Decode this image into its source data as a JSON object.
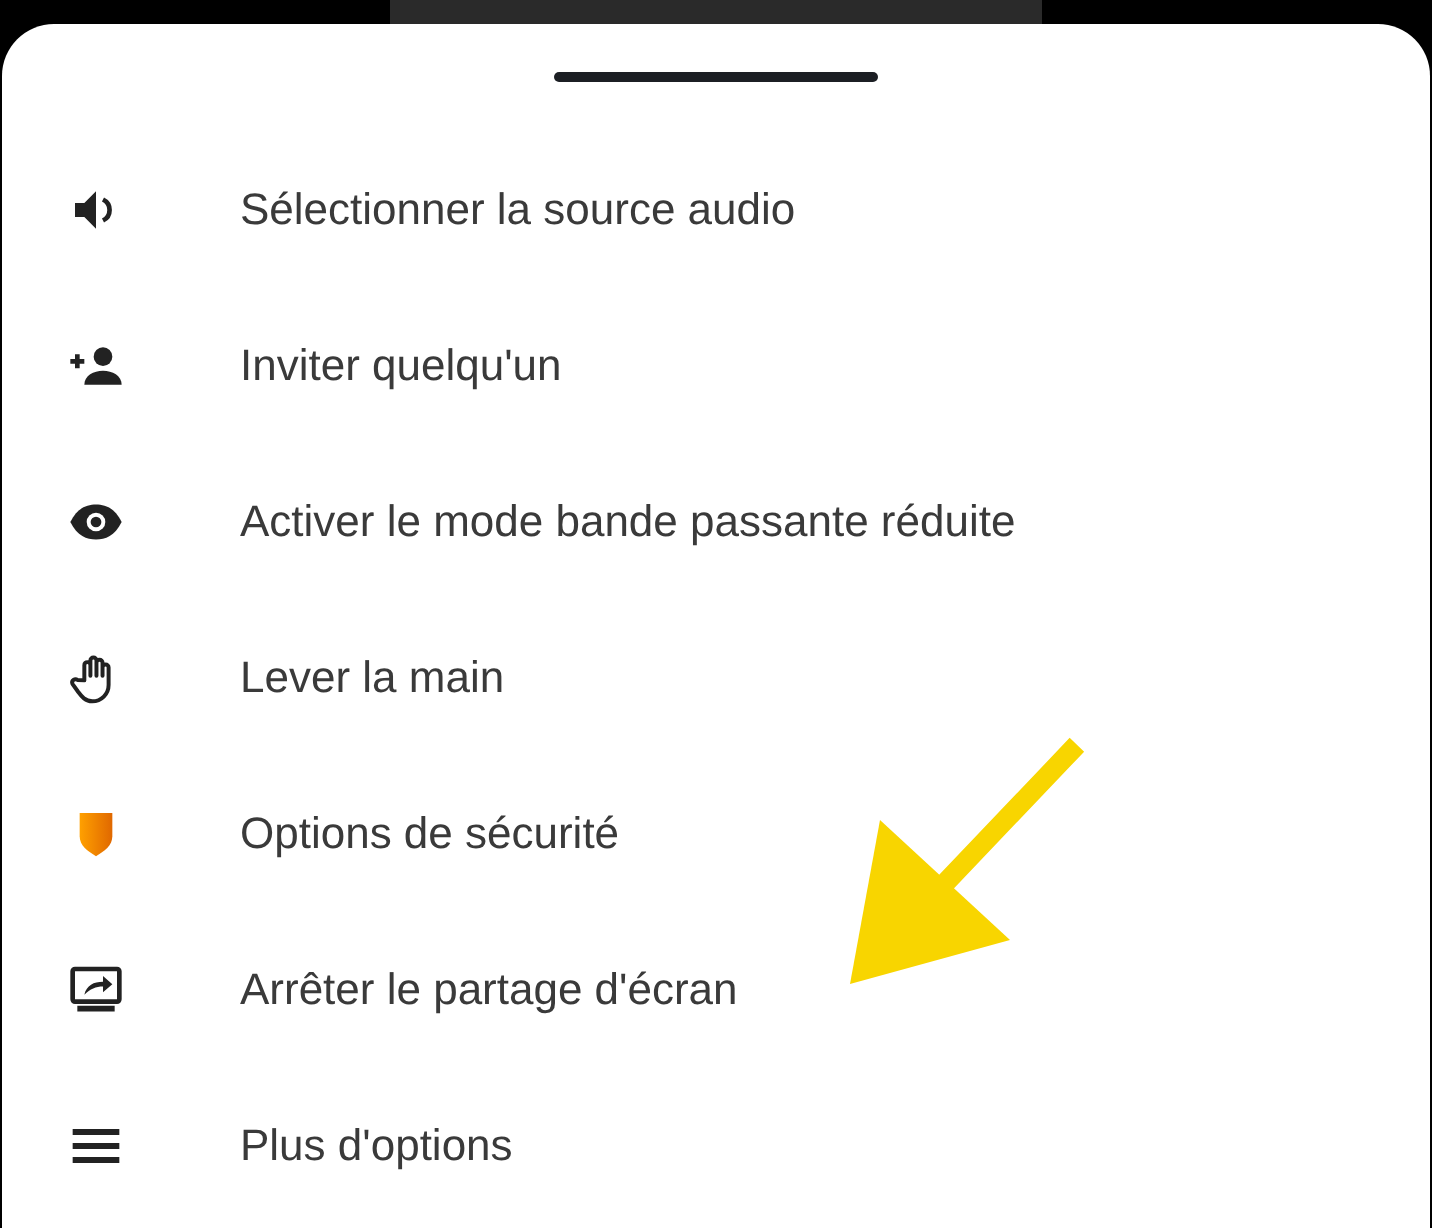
{
  "menu": {
    "items": [
      {
        "kind": "speaker",
        "label": "Sélectionner la source audio"
      },
      {
        "kind": "person-add",
        "label": "Inviter quelqu'un"
      },
      {
        "kind": "eye",
        "label": "Activer le mode bande passante réduite"
      },
      {
        "kind": "hand",
        "label": "Lever la main"
      },
      {
        "kind": "shield",
        "label": "Options de sécurité"
      },
      {
        "kind": "screen-share",
        "label": "Arrêter le partage d'écran"
      },
      {
        "kind": "menu",
        "label": "Plus d'options"
      }
    ]
  }
}
